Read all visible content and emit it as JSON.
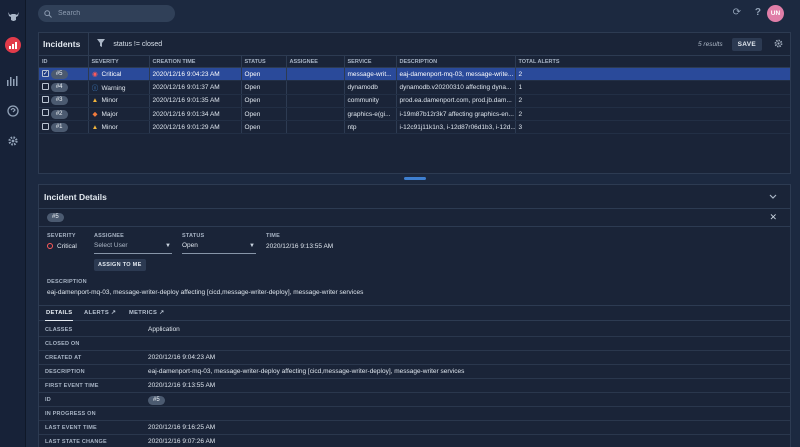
{
  "search": {
    "placeholder": "Search"
  },
  "user": {
    "initials": "UN"
  },
  "incidents": {
    "title": "Incidents",
    "filter": "status != closed",
    "results": "5 results",
    "save_label": "SAVE",
    "columns": [
      "ID",
      "SEVERITY",
      "CREATION TIME",
      "STATUS",
      "ASSIGNEE",
      "SERVICE",
      "DESCRIPTION",
      "TOTAL ALERTS"
    ],
    "rows": [
      {
        "selected": true,
        "id": "#5",
        "severity": "Critical",
        "sev_color": "#ff5a5a",
        "created": "2020/12/16 9:04:23 AM",
        "status": "Open",
        "assignee": "",
        "service": "message-writ...",
        "description": "eaj-damenport-mq-03, message-write...",
        "alerts": "2"
      },
      {
        "selected": false,
        "id": "#4",
        "severity": "Warning",
        "sev_color": "#4a9bf0",
        "created": "2020/12/16 9:01:37 AM",
        "status": "Open",
        "assignee": "",
        "service": "dynamodb",
        "description": "dynamodb.v20200310 affecting dyna...",
        "alerts": "1"
      },
      {
        "selected": false,
        "id": "#3",
        "severity": "Minor",
        "sev_color": "#f0b43c",
        "created": "2020/12/16 9:01:35 AM",
        "status": "Open",
        "assignee": "",
        "service": "community",
        "description": "prod.ea.damenport.com, prod.jb.dam...",
        "alerts": "2"
      },
      {
        "selected": false,
        "id": "#2",
        "severity": "Major",
        "sev_color": "#f07a3c",
        "created": "2020/12/16 9:01:34 AM",
        "status": "Open",
        "assignee": "",
        "service": "graphics-e(gi...",
        "description": "i-19m87b12r3k7 affecting graphics-en...",
        "alerts": "2"
      },
      {
        "selected": false,
        "id": "#1",
        "severity": "Minor",
        "sev_color": "#f0b43c",
        "created": "2020/12/16 9:01:29 AM",
        "status": "Open",
        "assignee": "",
        "service": "ntp",
        "description": "i-12c91j11k1n3, i-12d87r06d1b3, i-12d...",
        "alerts": "3"
      }
    ]
  },
  "details": {
    "title": "Incident Details",
    "id_chip": "#5",
    "severity_label": "SEVERITY",
    "severity_value": "Critical",
    "severity_color": "#ff5a5a",
    "assignee_label": "ASSIGNEE",
    "assignee_placeholder": "Select User",
    "assign_button": "ASSIGN TO ME",
    "status_label": "STATUS",
    "status_value": "Open",
    "time_label": "TIME",
    "time_value": "2020/12/16 9:13:55 AM",
    "description_label": "DESCRIPTION",
    "description_value": "eaj-damenport-mq-03, message-writer-deploy affecting [cicd,message-writer-deploy], message-writer services",
    "tabs": [
      "DETAILS",
      "ALERTS",
      "METRICS"
    ],
    "fields": [
      {
        "k": "CLASSES",
        "v": "Application"
      },
      {
        "k": "CLOSED ON",
        "v": ""
      },
      {
        "k": "CREATED AT",
        "v": "2020/12/16 9:04:23 AM"
      },
      {
        "k": "DESCRIPTION",
        "v": "eaj-damenport-mq-03, message-writer-deploy affecting [cicd,message-writer-deploy], message-writer services"
      },
      {
        "k": "FIRST EVENT TIME",
        "v": "2020/12/16 9:13:55 AM"
      },
      {
        "k": "ID",
        "v": "#5"
      },
      {
        "k": "IN PROGRESS ON",
        "v": ""
      },
      {
        "k": "LAST EVENT TIME",
        "v": "2020/12/16 9:16:25 AM"
      },
      {
        "k": "LAST STATE CHANGE",
        "v": "2020/12/16 9:07:26 AM"
      }
    ]
  }
}
